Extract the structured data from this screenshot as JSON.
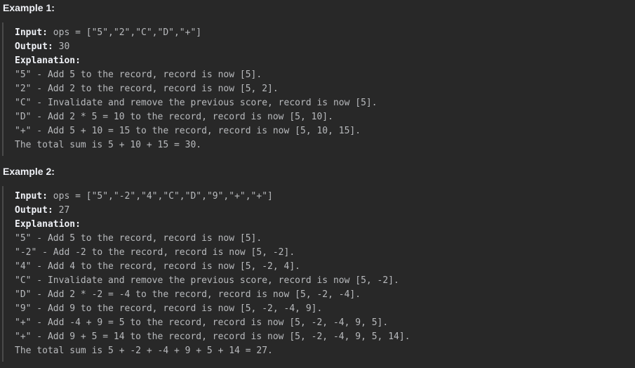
{
  "examples": [
    {
      "title": "Example 1:",
      "input_label": "Input:",
      "input_value": " ops = [\"5\",\"2\",\"C\",\"D\",\"+\"]",
      "output_label": "Output:",
      "output_value": " 30",
      "explanation_label": "Explanation:",
      "lines": [
        "\"5\" - Add 5 to the record, record is now [5].",
        "\"2\" - Add 2 to the record, record is now [5, 2].",
        "\"C\" - Invalidate and remove the previous score, record is now [5].",
        "\"D\" - Add 2 * 5 = 10 to the record, record is now [5, 10].",
        "\"+\" - Add 5 + 10 = 15 to the record, record is now [5, 10, 15].",
        "The total sum is 5 + 10 + 15 = 30."
      ]
    },
    {
      "title": "Example 2:",
      "input_label": "Input:",
      "input_value": " ops = [\"5\",\"-2\",\"4\",\"C\",\"D\",\"9\",\"+\",\"+\"]",
      "output_label": "Output:",
      "output_value": " 27",
      "explanation_label": "Explanation:",
      "lines": [
        "\"5\" - Add 5 to the record, record is now [5].",
        "\"-2\" - Add -2 to the record, record is now [5, -2].",
        "\"4\" - Add 4 to the record, record is now [5, -2, 4].",
        "\"C\" - Invalidate and remove the previous score, record is now [5, -2].",
        "\"D\" - Add 2 * -2 = -4 to the record, record is now [5, -2, -4].",
        "\"9\" - Add 9 to the record, record is now [5, -2, -4, 9].",
        "\"+\" - Add -4 + 9 = 5 to the record, record is now [5, -2, -4, 9, 5].",
        "\"+\" - Add 9 + 5 = 14 to the record, record is now [5, -2, -4, 9, 5, 14].",
        "The total sum is 5 + -2 + -4 + 9 + 5 + 14 = 27."
      ]
    }
  ]
}
